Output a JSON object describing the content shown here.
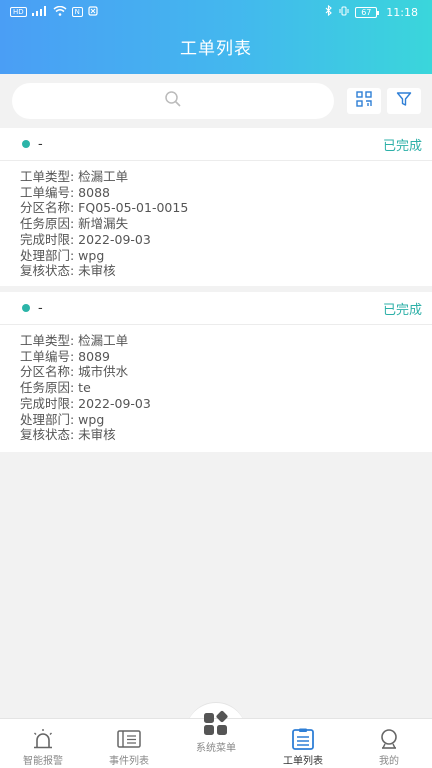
{
  "status_bar": {
    "left_chip_1": "HD",
    "left_signal": "⁴⁶",
    "left_chip_2": "N",
    "battery": "67",
    "time": "11:18"
  },
  "header": {
    "title": "工单列表"
  },
  "search": {
    "placeholder": ""
  },
  "cards": [
    {
      "name": "-",
      "status": "已完成",
      "fields": [
        "工单类型: 检漏工单",
        "工单编号: 8088",
        "分区名称: FQ05-05-01-0015",
        "任务原因: 新增漏失",
        "完成时限: 2022-09-03",
        "处理部门: wpg",
        "复核状态: 未审核"
      ]
    },
    {
      "name": "-",
      "status": "已完成",
      "fields": [
        "工单类型: 检漏工单",
        "工单编号: 8089",
        "分区名称: 城市供水",
        "任务原因: te",
        "完成时限: 2022-09-03",
        "处理部门: wpg",
        "复核状态: 未审核"
      ]
    }
  ],
  "tabbar": {
    "items": [
      {
        "label": "智能报警",
        "icon": "alarm-icon"
      },
      {
        "label": "事件列表",
        "icon": "list-icon"
      },
      {
        "label": "系统菜单",
        "icon": "menu-grid-icon"
      },
      {
        "label": "工单列表",
        "icon": "clipboard-icon",
        "active": true
      },
      {
        "label": "我的",
        "icon": "person-icon"
      }
    ]
  },
  "colors": {
    "header_start": "#4a9ef5",
    "header_end": "#3ad6db",
    "status_done": "#2db0a8",
    "tab_active_icon": "#2f7fd6"
  }
}
